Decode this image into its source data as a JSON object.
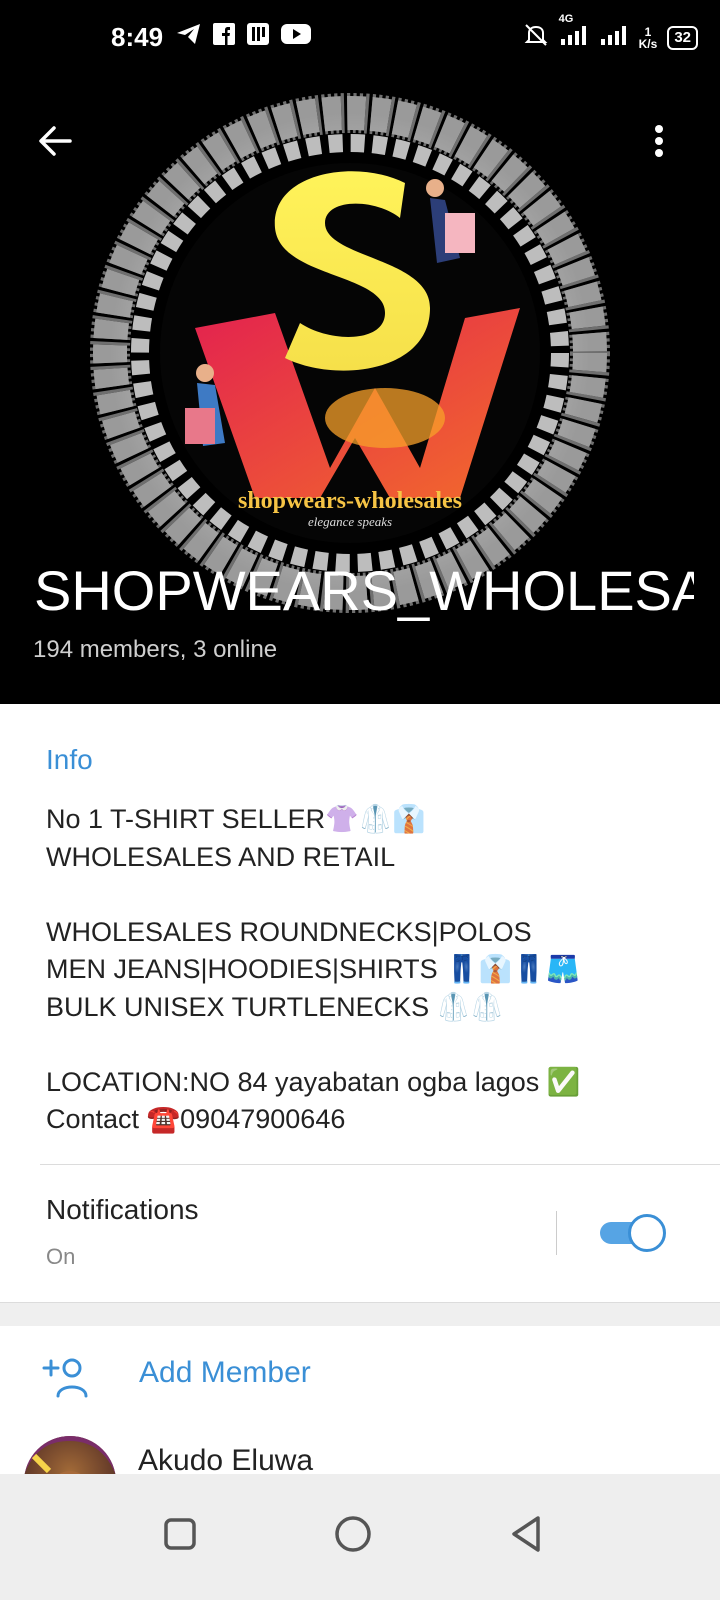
{
  "status_bar": {
    "time": "8:49",
    "network": "4G",
    "speed_value": "1",
    "speed_unit": "K/s",
    "battery": "32"
  },
  "header": {
    "logo_text": "shopwears-wholesales",
    "logo_tagline": "elegance speaks",
    "title": "SHOPWEARS_WHOLESALES",
    "subtitle": "194 members, 3 online"
  },
  "info": {
    "label": "Info",
    "description": "No 1 T-SHIRT SELLER👚🥼👔\nWHOLESALES AND RETAIL\n\nWHOLESALES ROUNDNECKS|POLOS\nMEN JEANS|HOODIES|SHIRTS 👖👔👖🩳\nBULK UNISEX TURTLENECKS 🥼🥼\n\nLOCATION:NO 84 yayabatan ogba lagos ✅\nContact ☎️09047900646"
  },
  "notifications": {
    "title": "Notifications",
    "status": "On",
    "enabled": true
  },
  "members": {
    "add_label": "Add Member",
    "list": [
      {
        "name": "Akudo Eluwa"
      }
    ]
  },
  "colors": {
    "accent": "#3a8fd6",
    "toggle_track": "#56a4e4",
    "header_bg": "#000000"
  }
}
